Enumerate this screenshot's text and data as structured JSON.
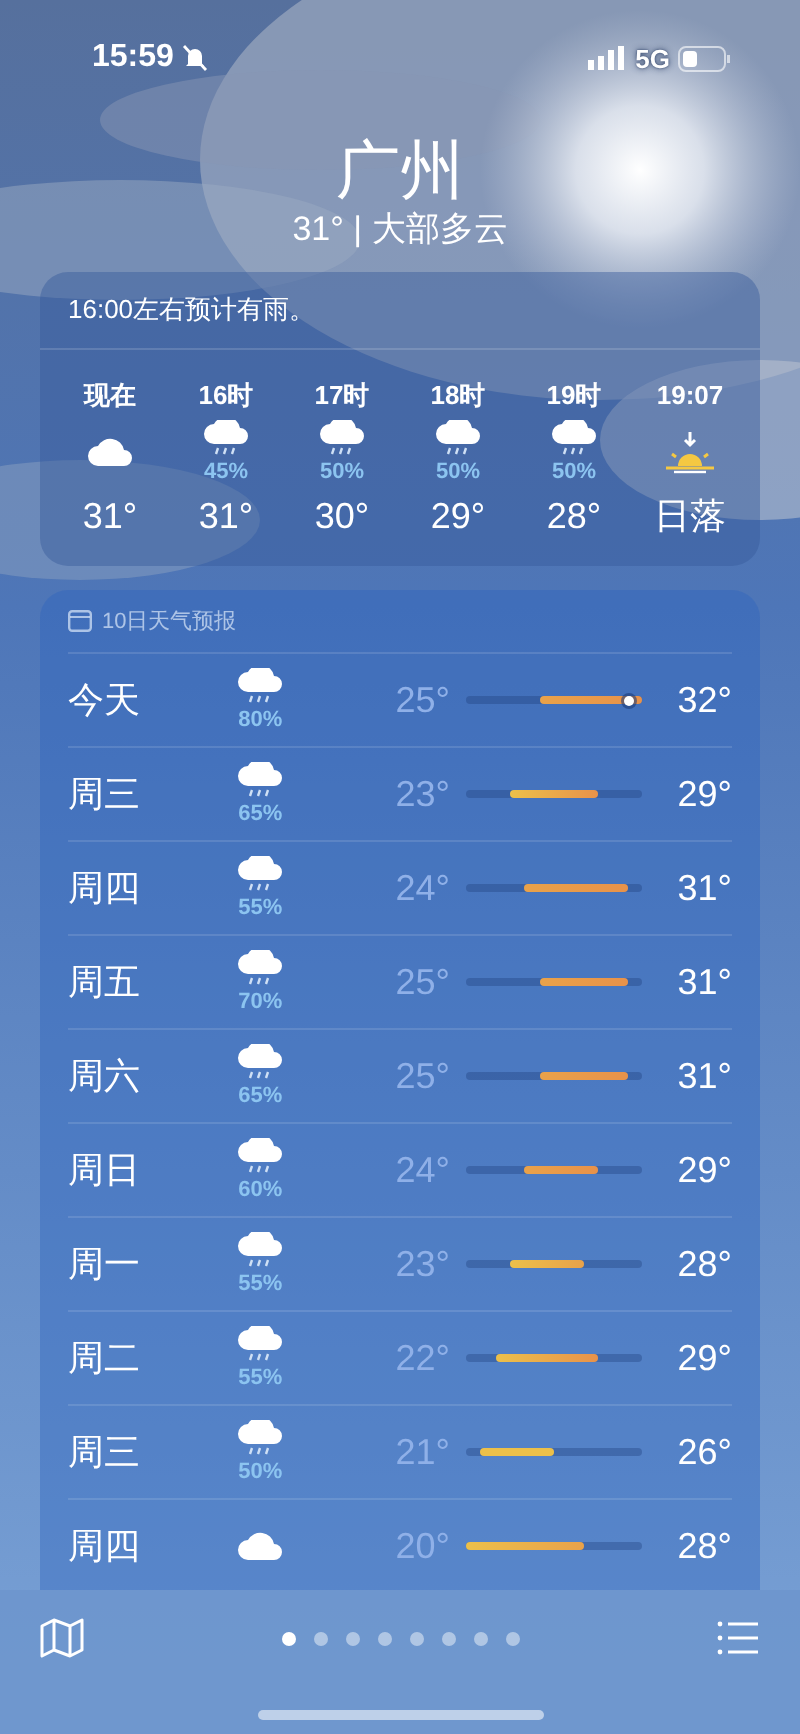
{
  "status_bar": {
    "time": "15:59",
    "muted": true,
    "network": "5G"
  },
  "location": {
    "city": "广州",
    "summary": "31° | 大部多云"
  },
  "hourly": {
    "summary": "16:00左右预计有雨。",
    "hours": [
      {
        "label": "现在",
        "kind": "cloud",
        "temp": "31°"
      },
      {
        "label": "16时",
        "kind": "rain",
        "precip": "45%",
        "temp": "31°"
      },
      {
        "label": "17时",
        "kind": "rain",
        "precip": "50%",
        "temp": "30°"
      },
      {
        "label": "18时",
        "kind": "rain",
        "precip": "50%",
        "temp": "29°"
      },
      {
        "label": "19时",
        "kind": "rain",
        "precip": "50%",
        "temp": "28°"
      },
      {
        "label": "19:07",
        "kind": "sunset",
        "temp": "日落"
      }
    ]
  },
  "daily": {
    "title": "10日天气预报",
    "days": [
      {
        "day": "今天",
        "kind": "rain",
        "precip": "80%",
        "low": "25°",
        "high": "32°",
        "now_marker": true
      },
      {
        "day": "周三",
        "kind": "rain",
        "precip": "65%",
        "low": "23°",
        "high": "29°",
        "now_marker": false
      },
      {
        "day": "周四",
        "kind": "rain",
        "precip": "55%",
        "low": "24°",
        "high": "31°",
        "now_marker": false
      },
      {
        "day": "周五",
        "kind": "rain",
        "precip": "70%",
        "low": "25°",
        "high": "31°",
        "now_marker": false
      },
      {
        "day": "周六",
        "kind": "rain",
        "precip": "65%",
        "low": "25°",
        "high": "31°",
        "now_marker": false
      },
      {
        "day": "周日",
        "kind": "rain",
        "precip": "60%",
        "low": "24°",
        "high": "29°",
        "now_marker": false
      },
      {
        "day": "周一",
        "kind": "rain",
        "precip": "55%",
        "low": "23°",
        "high": "28°",
        "now_marker": false
      },
      {
        "day": "周二",
        "kind": "rain",
        "precip": "55%",
        "low": "22°",
        "high": "29°",
        "now_marker": false
      },
      {
        "day": "周三",
        "kind": "rain",
        "precip": "50%",
        "low": "21°",
        "high": "26°",
        "now_marker": false
      },
      {
        "day": "周四",
        "kind": "cloud",
        "low": "20°",
        "high": "28°",
        "now_marker": false
      }
    ]
  },
  "page_dots": [
    {
      "selected": true
    },
    {
      "selected": false
    },
    {
      "selected": false
    },
    {
      "selected": false
    },
    {
      "selected": false
    },
    {
      "selected": false
    },
    {
      "selected": false
    },
    {
      "selected": false
    }
  ]
}
